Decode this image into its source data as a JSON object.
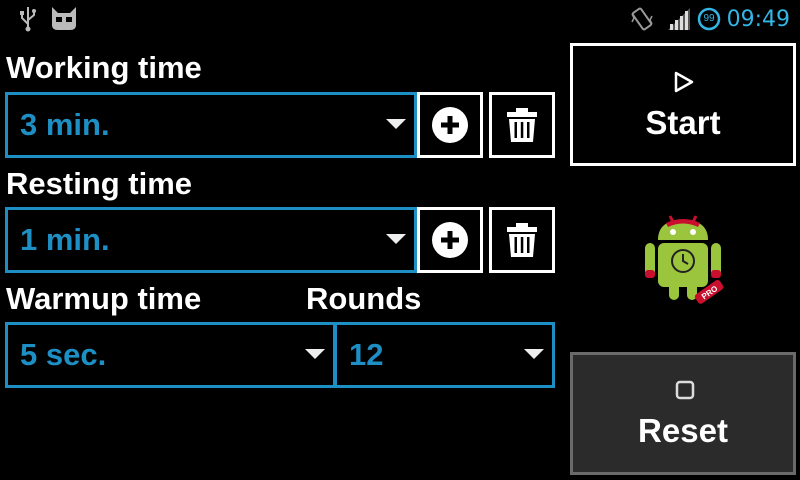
{
  "status_bar": {
    "time": "09:49",
    "battery": "99",
    "icons": [
      "usb-icon",
      "cyanogen-icon",
      "vibrate-icon",
      "signal-icon",
      "battery-icon"
    ]
  },
  "working": {
    "label": "Working time",
    "value": "3 min."
  },
  "resting": {
    "label": "Resting time",
    "value": "1 min."
  },
  "warmup": {
    "label": "Warmup time",
    "value": "5 sec."
  },
  "rounds": {
    "label": "Rounds",
    "value": "12"
  },
  "start": {
    "label": "Start",
    "icon": "play-icon"
  },
  "reset": {
    "label": "Reset",
    "icon": "stop-icon"
  },
  "colors": {
    "accent": "#1d8fc4",
    "status": "#33b5e5",
    "background": "#000000"
  }
}
